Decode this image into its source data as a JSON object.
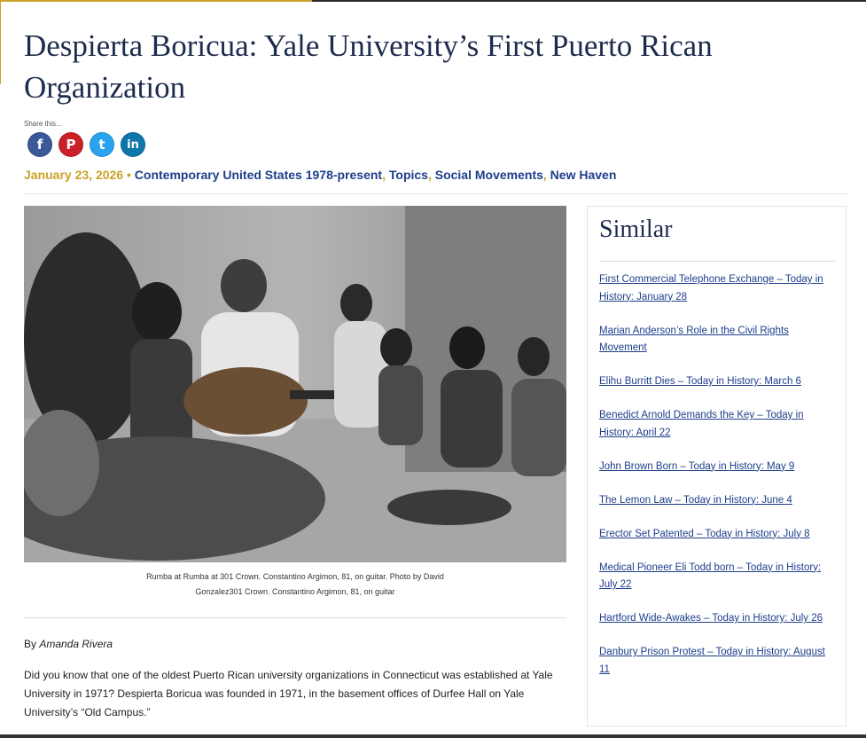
{
  "article": {
    "title": "Despierta Boricua: Yale University’s First Puerto Rican Organization",
    "share_label": "Share this...",
    "share": [
      {
        "network": "facebook",
        "icon": "facebook-icon",
        "glyph": "f"
      },
      {
        "network": "pinterest",
        "icon": "pinterest-icon",
        "glyph": "P"
      },
      {
        "network": "twitter",
        "icon": "twitter-icon",
        "glyph": "t"
      },
      {
        "network": "linkedin",
        "icon": "linkedin-icon",
        "glyph": "in"
      }
    ],
    "date": "January 23, 2026",
    "bullet": "•",
    "categories": [
      "Contemporary United States 1978-present",
      "Topics",
      "Social Movements",
      "New Haven"
    ],
    "comma": ",",
    "image_alt": "Rumba at 301 Crown photo",
    "caption_line1": "Rumba at Rumba at 301 Crown. Constantino Argimon, 81, on guitar. Photo by David",
    "caption_line2": "Gonzalez301 Crown. Constantino Argimon, 81, on guitar",
    "by_label": "By",
    "author": "Amanda Rivera",
    "body": "Did you know that one of the oldest Puerto Rican university organizations in Connecticut was established at Yale University in 1971? Despierta Boricua was founded in 1971, in the basement offices of Durfee Hall on Yale University’s “Old Campus.”"
  },
  "sidebar": {
    "heading": "Similar",
    "links": [
      "First Commercial Telephone Exchange – Today in History: January 28",
      "Marian Anderson’s Role in the Civil Rights Movement",
      "Elihu Burritt Dies – Today in History: March 6",
      "Benedict Arnold Demands the Key – Today in History: April 22",
      "John Brown Born – Today in History: May 9",
      "The Lemon Law – Today in History: June 4",
      "Erector Set Patented – Today in History: July 8",
      "Medical Pioneer Eli Todd born – Today in History: July 22",
      "Hartford Wide-Awakes – Today in History: July 26",
      "Danbury Prison Protest – Today in History: August 11"
    ]
  },
  "colors": {
    "gold": "#c9a227",
    "navy": "#1d2b4d",
    "link": "#1d3e8a"
  }
}
